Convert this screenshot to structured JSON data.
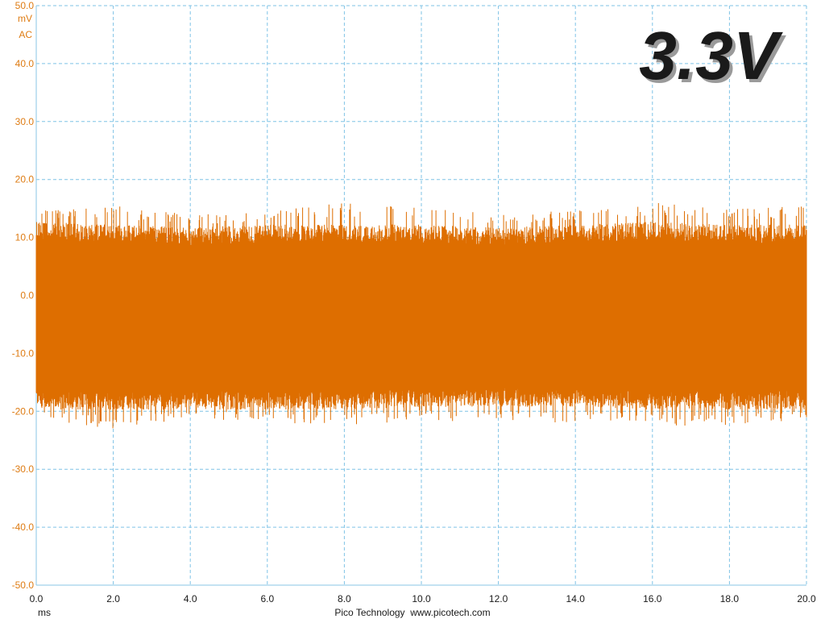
{
  "chart_data": {
    "type": "line",
    "title": "",
    "annotation": "3.3V",
    "xlabel": "ms",
    "ylabel": "mV",
    "ylabel_coupling": "AC",
    "xlim": [
      0.0,
      20.0
    ],
    "ylim": [
      -50.0,
      50.0
    ],
    "xticks": [
      "0.0",
      "2.0",
      "4.0",
      "6.0",
      "8.0",
      "10.0",
      "12.0",
      "14.0",
      "16.0",
      "18.0",
      "20.0"
    ],
    "yticks": [
      "50.0",
      "40.0",
      "30.0",
      "20.0",
      "10.0",
      "0.0",
      "-10.0",
      "-20.0",
      "-30.0",
      "-40.0",
      "-50.0"
    ],
    "grid": true,
    "footer": "Pico Technology  www.picotech.com",
    "colors": {
      "trace": "#de6e00",
      "axis_text": "#de7b12",
      "grid": "#7fc3e6",
      "axis_line": "#8ac6e6"
    },
    "series": [
      {
        "values_description_free": true,
        "envelope": {
          "x": [
            0.0,
            2.0,
            4.0,
            6.0,
            8.0,
            10.0,
            12.0,
            14.0,
            16.0,
            18.0,
            20.0
          ],
          "upper_typical": [
            11.5,
            11.0,
            10.5,
            11.0,
            11.0,
            11.0,
            10.5,
            11.0,
            11.5,
            11.0,
            11.0
          ],
          "lower_typical": [
            -18.5,
            -18.5,
            -18.5,
            -18.5,
            -18.5,
            -18.0,
            -18.0,
            -18.0,
            -18.5,
            -18.5,
            -18.5
          ],
          "upper_peak": [
            15.0,
            15.5,
            14.0,
            14.5,
            16.0,
            15.5,
            14.0,
            15.0,
            16.0,
            15.0,
            15.5
          ],
          "lower_peak": [
            -21.5,
            -23.0,
            -21.5,
            -22.0,
            -22.5,
            -21.5,
            -22.0,
            -22.0,
            -22.5,
            -22.5,
            -21.5
          ]
        }
      }
    ]
  }
}
